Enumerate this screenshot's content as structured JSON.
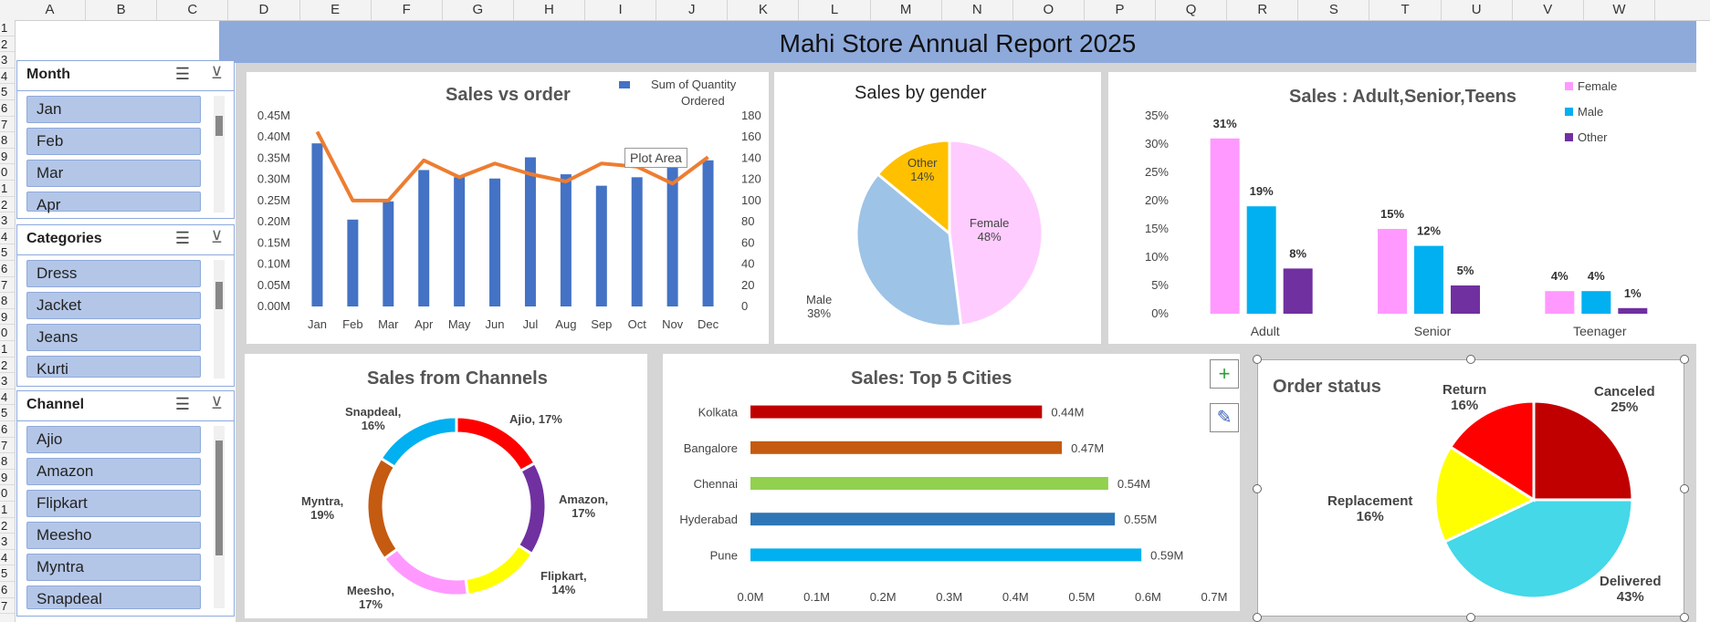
{
  "sheet": {
    "columns": [
      "A",
      "B",
      "C",
      "D",
      "E",
      "F",
      "G",
      "H",
      "I",
      "J",
      "K",
      "L",
      "M",
      "N",
      "O",
      "P",
      "Q",
      "R",
      "S",
      "T",
      "U",
      "V",
      "W"
    ],
    "rows": [
      "1",
      "2",
      "3",
      "4",
      "5",
      "6",
      "7",
      "8",
      "9",
      "0",
      "1",
      "2",
      "3",
      "4",
      "5",
      "6",
      "7",
      "8",
      "9",
      "0",
      "1",
      "2",
      "3",
      "4",
      "5",
      "6",
      "7",
      "8",
      "9",
      "0",
      "1",
      "2",
      "3",
      "4",
      "5",
      "6",
      "7"
    ]
  },
  "banner": {
    "title": "Mahi Store Annual Report 2025",
    "color": "#8eaadb"
  },
  "slicers": {
    "month": {
      "title": "Month",
      "items": [
        "Jan",
        "Feb",
        "Mar",
        "Apr"
      ]
    },
    "categories": {
      "title": "Categories",
      "items": [
        "Dress",
        "Jacket",
        "Jeans",
        "Kurti"
      ]
    },
    "channel": {
      "title": "Channel",
      "items": [
        "Ajio",
        "Amazon",
        "Flipkart",
        "Meesho",
        "Myntra",
        "Snapdeal"
      ]
    }
  },
  "chart_data": [
    {
      "type": "bar",
      "title": "Sales vs order",
      "categories": [
        "Jan",
        "Feb",
        "Mar",
        "Apr",
        "May",
        "Jun",
        "Jul",
        "Aug",
        "Sep",
        "Oct",
        "Nov",
        "Dec"
      ],
      "series": [
        {
          "name": "Sum of Quantity Ordered",
          "kind": "bar",
          "color": "#4472c4",
          "values": [
            0.385,
            0.205,
            0.248,
            0.322,
            0.305,
            0.302,
            0.352,
            0.312,
            0.285,
            0.305,
            0.33,
            0.345
          ]
        },
        {
          "name": "",
          "kind": "line",
          "color": "#ed7d31",
          "values": [
            165,
            100,
            100,
            138,
            122,
            135,
            125,
            118,
            135,
            132,
            116,
            141
          ]
        }
      ],
      "y_left": {
        "range": [
          0,
          0.45
        ],
        "ticks": [
          "0.00M",
          "0.05M",
          "0.10M",
          "0.15M",
          "0.20M",
          "0.25M",
          "0.30M",
          "0.35M",
          "0.40M",
          "0.45M"
        ]
      },
      "y_right": {
        "range": [
          0,
          180
        ],
        "ticks": [
          "0",
          "20",
          "40",
          "60",
          "80",
          "100",
          "120",
          "140",
          "160",
          "180"
        ]
      },
      "legend_label_1": "Sum of Quantity",
      "legend_label_2": "Ordered",
      "tooltip": "Plot Area"
    },
    {
      "type": "pie",
      "title": "Sales by gender",
      "slices": [
        {
          "name": "Female",
          "value": 48,
          "label": "48%",
          "color": "#ffccff"
        },
        {
          "name": "Male",
          "value": 38,
          "label": "38%",
          "color": "#9dc3e6"
        },
        {
          "name": "Other",
          "value": 14,
          "label": "14%",
          "color": "#ffc000"
        }
      ]
    },
    {
      "type": "bar",
      "title": "Sales : Adult,Senior,Teens",
      "categories": [
        "Adult",
        "Senior",
        "Teenager"
      ],
      "series": [
        {
          "name": "Female",
          "color": "#ff99ff",
          "values": [
            31,
            15,
            4
          ]
        },
        {
          "name": "Male",
          "color": "#00b0f0",
          "values": [
            19,
            12,
            4
          ]
        },
        {
          "name": "Other",
          "color": "#7030a0",
          "values": [
            8,
            5,
            1
          ]
        }
      ],
      "ylim": [
        0,
        35
      ],
      "y_ticks": [
        "0%",
        "5%",
        "10%",
        "15%",
        "20%",
        "25%",
        "30%",
        "35%"
      ]
    },
    {
      "type": "pie",
      "title": "Sales from Channels",
      "donut": true,
      "slices": [
        {
          "name": "Ajio",
          "value": 17,
          "color": "#ff0000"
        },
        {
          "name": "Amazon",
          "value": 17,
          "color": "#7030a0"
        },
        {
          "name": "Flipkart",
          "value": 14,
          "color": "#ffff00"
        },
        {
          "name": "Meesho",
          "value": 17,
          "color": "#ff99ff"
        },
        {
          "name": "Myntra",
          "value": 19,
          "color": "#c55a11"
        },
        {
          "name": "Snapdeal",
          "value": 16,
          "color": "#00b0f0"
        }
      ],
      "labels": [
        "Ajio, 17%",
        "Amazon,",
        "17%",
        "Flipkart,",
        "14%",
        "Meesho,",
        "17%",
        "Myntra,",
        "19%",
        "Snapdeal,",
        "16%"
      ]
    },
    {
      "type": "bar",
      "orientation": "horizontal",
      "title": "Sales: Top 5 Cities",
      "categories": [
        "Kolkata",
        "Bangalore",
        "Chennai",
        "Hyderabad",
        "Pune"
      ],
      "values": [
        0.44,
        0.47,
        0.54,
        0.55,
        0.59
      ],
      "value_labels": [
        "0.44M",
        "0.47M",
        "0.54M",
        "0.55M",
        "0.59M"
      ],
      "colors": [
        "#c00000",
        "#c55a11",
        "#92d050",
        "#2e75b6",
        "#00b0f0"
      ],
      "xlim": [
        0,
        0.7
      ],
      "x_ticks": [
        "0.0M",
        "0.1M",
        "0.2M",
        "0.3M",
        "0.4M",
        "0.5M",
        "0.6M",
        "0.7M"
      ]
    },
    {
      "type": "pie",
      "title": "Order status",
      "slices": [
        {
          "name": "Canceled",
          "value": 25,
          "label": "25%",
          "color": "#c00000"
        },
        {
          "name": "Delivered",
          "value": 43,
          "label": "43%",
          "color": "#44d8e8"
        },
        {
          "name": "Replacement",
          "value": 16,
          "label": "16%",
          "color": "#ffff00"
        },
        {
          "name": "Return",
          "value": 16,
          "label": "16%",
          "color": "#ff0000"
        }
      ]
    }
  ],
  "side_buttons": {
    "add": "+",
    "brush": "✎"
  }
}
